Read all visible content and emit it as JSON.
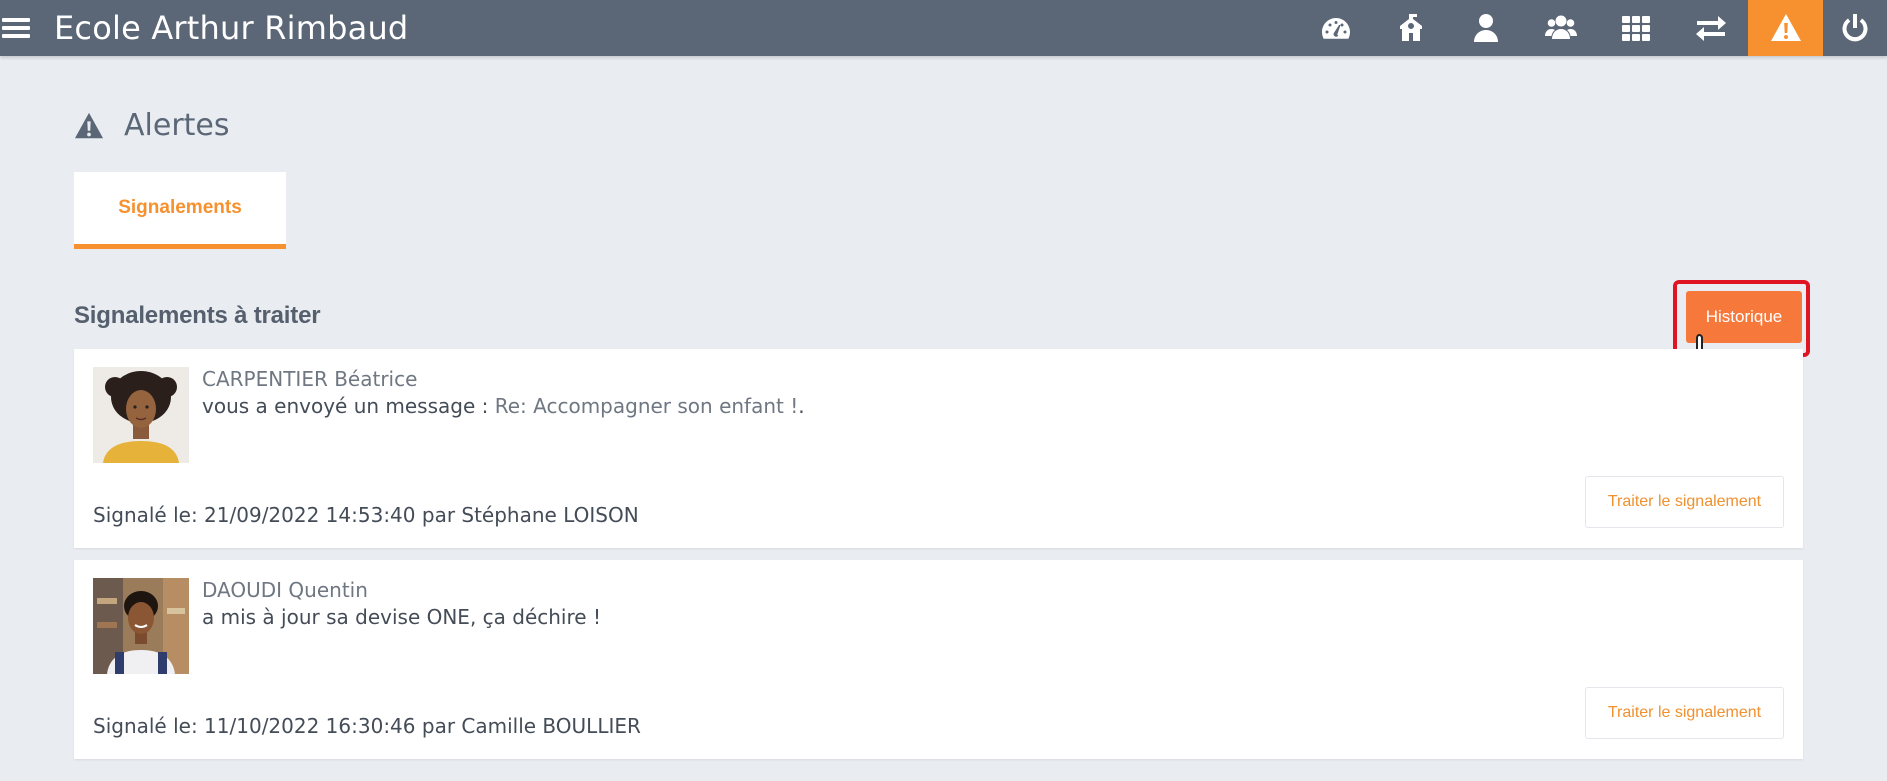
{
  "header": {
    "title": "Ecole Arthur Rimbaud",
    "nav_icons": [
      "dashboard-icon",
      "school-icon",
      "user-icon",
      "users-icon",
      "grid-icon",
      "exchange-icon",
      "alert-icon",
      "power-icon"
    ],
    "active_icon": "alert-icon",
    "accent_color": "#f7912f",
    "bar_color": "#5b6676"
  },
  "page": {
    "title": "Alertes",
    "icon": "alert-icon"
  },
  "tabs": [
    {
      "label": "Signalements",
      "active": true
    }
  ],
  "section": {
    "title": "Signalements à traiter",
    "history_button": "Historique",
    "highlight_color": "#e01524"
  },
  "reports": [
    {
      "name": "CARPENTIER Béatrice",
      "message_prefix": "vous a envoyé un message : ",
      "message_subject": "Re: Accompagner son enfant !",
      "message_suffix": ".",
      "meta": "Signalé le: 21/09/2022 14:53:40 par Stéphane LOISON",
      "action": "Traiter le signalement"
    },
    {
      "name": "DAOUDI Quentin",
      "message_prefix": "a mis à jour sa devise ONE, ça déchire !",
      "message_subject": "",
      "message_suffix": "",
      "meta": "Signalé le: 11/10/2022 16:30:46 par Camille BOULLIER",
      "action": "Traiter le signalement"
    }
  ]
}
